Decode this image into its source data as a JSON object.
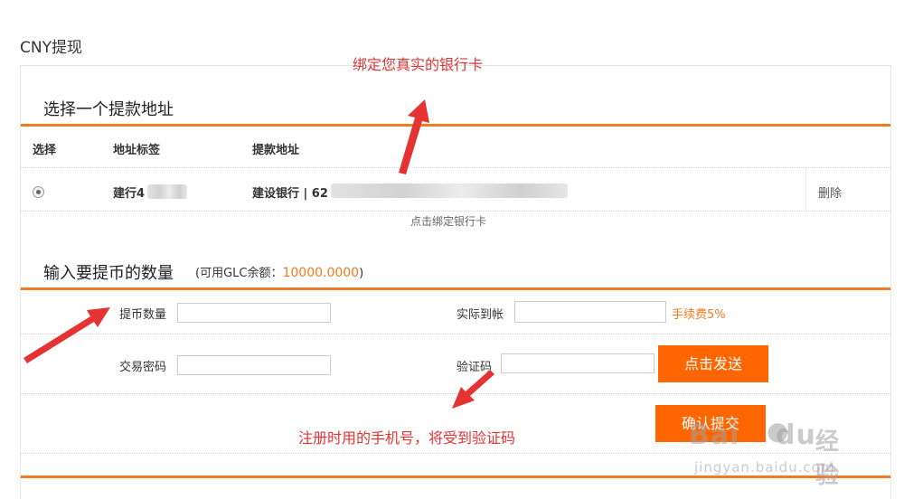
{
  "page_title": "CNY提现",
  "section1": {
    "title": "选择一个提款地址",
    "headers": [
      "选择",
      "地址标签",
      "提款地址"
    ],
    "row": {
      "label": "建行4",
      "address": "建设银行 | 62",
      "delete": "删除"
    },
    "bind_link": "点击绑定银行卡"
  },
  "section2": {
    "title": "输入要提币的数量",
    "balance_prefix": "(可用GLC余额：",
    "balance_amount": "10000.0000",
    "balance_suffix": ")",
    "fields": {
      "amount_label": "提币数量",
      "amount_value": "",
      "actual_label": "实际到帐",
      "actual_value": "",
      "fee_text": "手续费5%",
      "password_label": "交易密码",
      "password_value": "",
      "code_label": "验证码",
      "code_value": ""
    },
    "send_button": "点击发送",
    "submit_button": "确认提交"
  },
  "annotations": {
    "top": "绑定您真实的银行卡",
    "bottom": "注册时用的手机号，将受到验证码"
  },
  "watermark": {
    "brand": "Bai",
    "brand_du": "du",
    "brand_cn": "经验",
    "url": "jingyan.baidu.com"
  },
  "colors": {
    "accent": "#f47a20",
    "button": "#ff6600",
    "annotation": "#e53333"
  }
}
